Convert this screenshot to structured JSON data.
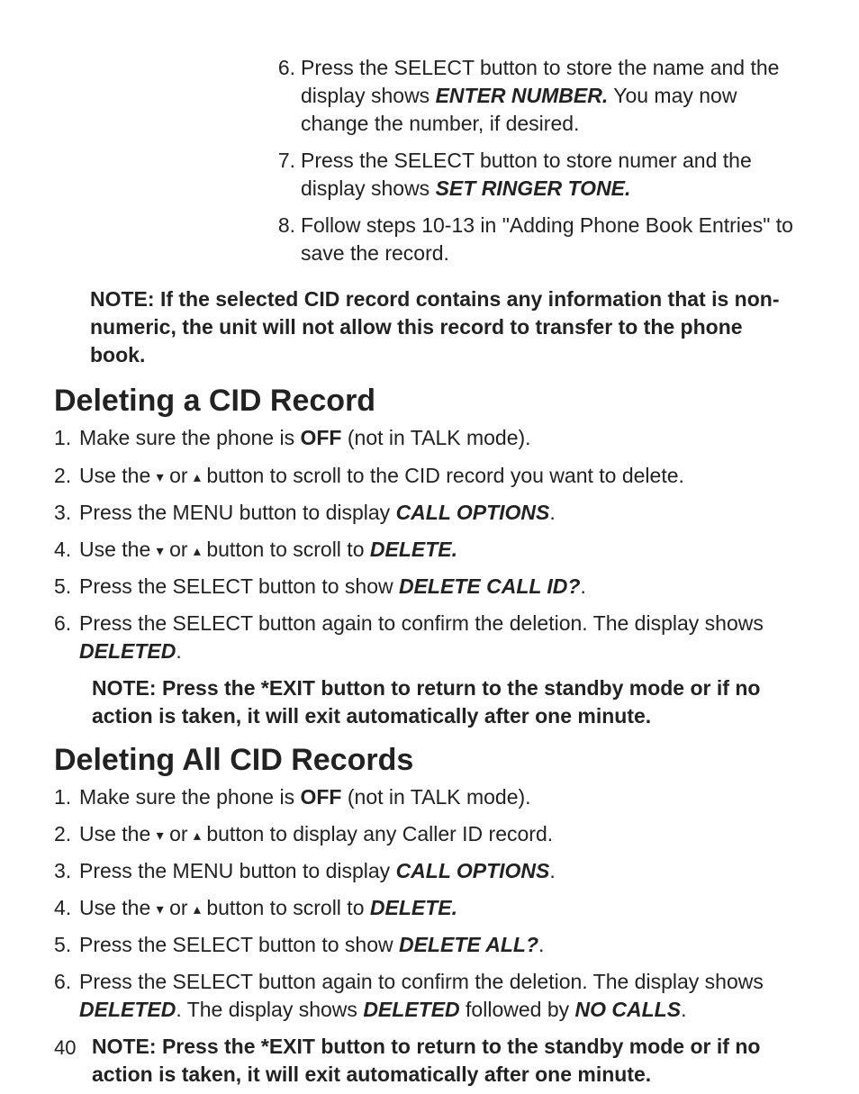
{
  "topList": [
    {
      "n": "6.",
      "pre": "Press the SELECT button to store the name and the display shows ",
      "emph": "ENTER NUMBER.",
      "post": "  You may now change the number, if desired."
    },
    {
      "n": "7.",
      "pre": "Press the SELECT button to store  numer and the display shows ",
      "emph": "SET RINGER TONE.",
      "post": ""
    },
    {
      "n": "8.",
      "pre": "Follow steps 10-13 in \"Adding Phone Book Entries\" to save the record.",
      "emph": "",
      "post": ""
    }
  ],
  "note1": "NOTE: If the selected CID record contains any information that is non-numeric, the unit will not allow this record to transfer to the phone book.",
  "h1": "Deleting a CID Record",
  "list1": [
    {
      "n": "1.",
      "segs": [
        {
          "t": "Make sure the phone is "
        },
        {
          "t": "OFF",
          "c": "b"
        },
        {
          "t": " (not in TALK mode)."
        }
      ]
    },
    {
      "n": "2.",
      "segs": [
        {
          "t": "Use the  "
        },
        {
          "t": "▾",
          "c": "arrow"
        },
        {
          "t": " or "
        },
        {
          "t": "▴",
          "c": "arrow"
        },
        {
          "t": " button to scroll to the CID record you want to delete."
        }
      ]
    },
    {
      "n": "3.",
      "segs": [
        {
          "t": "Press the MENU button to display "
        },
        {
          "t": "CALL OPTIONS",
          "c": "bi"
        },
        {
          "t": "."
        }
      ]
    },
    {
      "n": "4.",
      "segs": [
        {
          "t": "Use the  "
        },
        {
          "t": "▾",
          "c": "arrow"
        },
        {
          "t": " or "
        },
        {
          "t": "▴",
          "c": "arrow"
        },
        {
          "t": " button to scroll to "
        },
        {
          "t": "DELETE.",
          "c": "bi"
        }
      ]
    },
    {
      "n": "5.",
      "segs": [
        {
          "t": "Press the SELECT button to show "
        },
        {
          "t": "DELETE CALL ID?",
          "c": "bi"
        },
        {
          "t": "."
        }
      ]
    },
    {
      "n": "6.",
      "segs": [
        {
          "t": "Press the SELECT button again to confirm the deletion. The display shows "
        },
        {
          "t": "DELETED",
          "c": "bi"
        },
        {
          "t": "."
        }
      ]
    }
  ],
  "subnote1": "NOTE: Press the *EXIT button to return to the standby mode or if no action is taken, it will exit automatically after one minute.",
  "h2": "Deleting All CID Records",
  "list2": [
    {
      "n": "1.",
      "segs": [
        {
          "t": "Make sure the phone is "
        },
        {
          "t": "OFF",
          "c": "b"
        },
        {
          "t": " (not in TALK mode)."
        }
      ]
    },
    {
      "n": "2.",
      "segs": [
        {
          "t": "Use the  "
        },
        {
          "t": "▾",
          "c": "arrow"
        },
        {
          "t": " or "
        },
        {
          "t": "▴",
          "c": "arrow"
        },
        {
          "t": " button to display any Caller ID record."
        }
      ]
    },
    {
      "n": "3.",
      "segs": [
        {
          "t": "Press the MENU button to display "
        },
        {
          "t": "CALL OPTIONS",
          "c": "bi"
        },
        {
          "t": "."
        }
      ]
    },
    {
      "n": "4.",
      "segs": [
        {
          "t": "Use the  "
        },
        {
          "t": "▾",
          "c": "arrow"
        },
        {
          "t": " or "
        },
        {
          "t": "▴",
          "c": "arrow"
        },
        {
          "t": " button to scroll to "
        },
        {
          "t": "DELETE.",
          "c": "bi"
        }
      ]
    },
    {
      "n": "5.",
      "segs": [
        {
          "t": "Press the SELECT button to show "
        },
        {
          "t": "DELETE ALL?",
          "c": "bi"
        },
        {
          "t": "."
        }
      ]
    },
    {
      "n": "6.",
      "segs": [
        {
          "t": "Press the SELECT button again to confirm the deletion. The display shows "
        },
        {
          "t": "DELETED",
          "c": "bi"
        },
        {
          "t": ". The display shows "
        },
        {
          "t": "DELETED",
          "c": "bi"
        },
        {
          "t": " followed by "
        },
        {
          "t": "NO CALLS",
          "c": "bi"
        },
        {
          "t": "."
        }
      ]
    }
  ],
  "subnote2": "NOTE: Press the *EXIT button to return to the standby mode or if no action is taken, it will exit automatically after one minute.",
  "page": "40"
}
